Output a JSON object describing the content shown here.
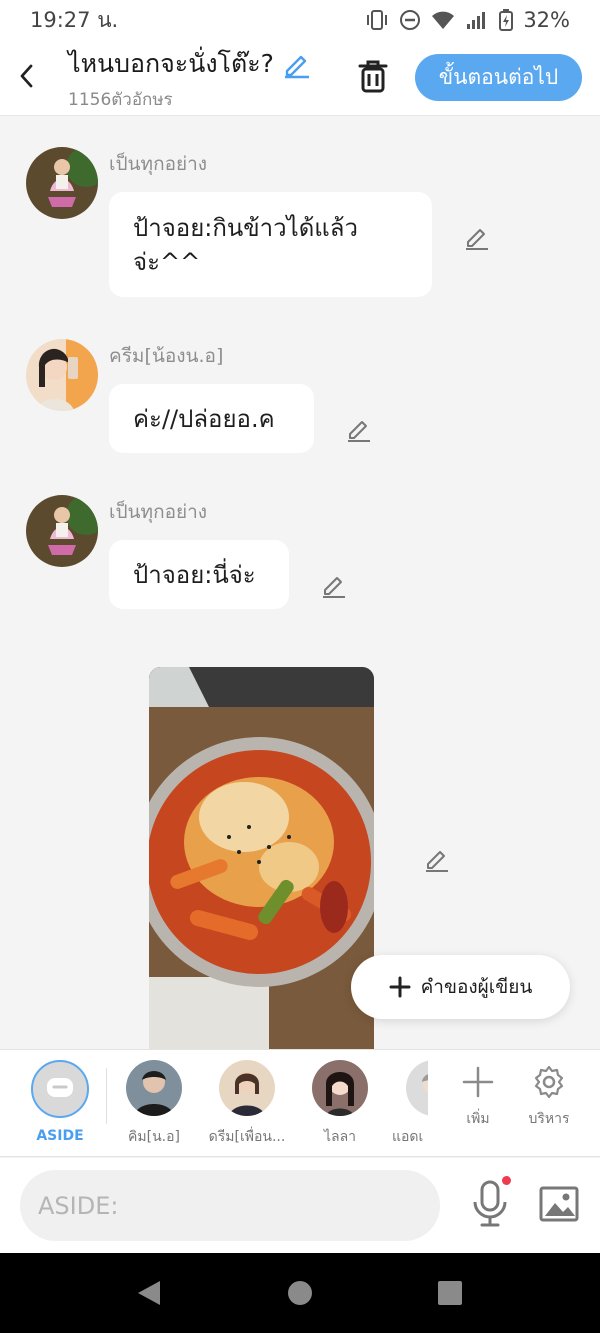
{
  "status_bar": {
    "time": "19:27 น.",
    "battery": "32%"
  },
  "header": {
    "title": "ไหนบอกจะนั่งโต๊ะ?",
    "char_count": "1156ตัวอักษร",
    "next_label": "ขั้นตอนต่อไป"
  },
  "messages": [
    {
      "sender": "เป็นทุกอย่าง",
      "text": "ป้าจอย:กินข้าวได้แล้วจ่ะ^^"
    },
    {
      "sender": "ครีม[น้องน.อ]",
      "text": "ค่ะ//ปล่อยอ.ค"
    },
    {
      "sender": "เป็นทุกอย่าง",
      "text": "ป้าจอย:นี่จ่ะ"
    }
  ],
  "author_note": {
    "label": "คำของผู้เขียน"
  },
  "characters": [
    {
      "label": "ASIDE"
    },
    {
      "label": "คิม[น.อ]"
    },
    {
      "label": "ดรีม[เพื่อน..."
    },
    {
      "label": "ไลลา"
    },
    {
      "label": "แอดเ"
    }
  ],
  "tools": {
    "add_label": "เพิ่ม",
    "manage_label": "บริหาร"
  },
  "input": {
    "placeholder": "ASIDE:"
  },
  "colors": {
    "accent": "#5aa8ef",
    "background": "#f4f4f4",
    "notification_dot": "#ee3b4f"
  }
}
